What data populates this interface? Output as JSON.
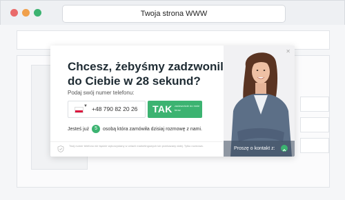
{
  "browser": {
    "title": "Twoja strona WWW",
    "dot_colors": [
      "#e96a6a",
      "#f0a04b",
      "#3cb371"
    ]
  },
  "popup": {
    "headline_line1": "Chcesz, żebyśmy zadzwonili",
    "headline_line2": "do Ciebie w 28 sekund?",
    "prompt": "Podaj swój numer telefonu:",
    "phone_value": "+48 790 82 20 26",
    "cta_label": "TAK",
    "cta_sub": "zadzwońcie do mnie teraz",
    "counter_before": "Jesteś już",
    "counter_number": "5",
    "counter_after": "osobą która zamówiła dzisiaj rozmowę z nami.",
    "privacy": "Twój numer telefonu nie będzie wykorzystany w celach marketingowych lub przekazany dalej. Tylko rozmowa.",
    "contact_label": "Proszę o kontakt z:"
  },
  "colors": {
    "accent": "#3cb371",
    "headline": "#1e2b33"
  }
}
